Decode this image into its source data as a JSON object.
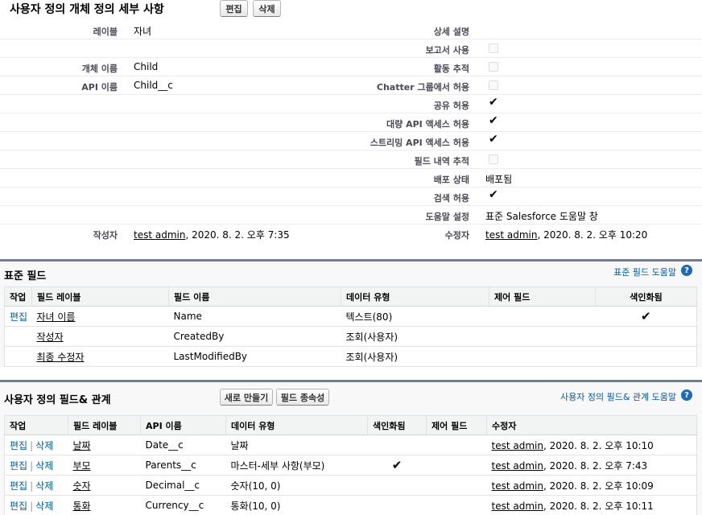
{
  "header": {
    "title": "사용자 정의 개체 정의 세부 사항",
    "edit_label": "편집",
    "delete_label": "삭제"
  },
  "detail": {
    "left": [
      {
        "label": "레이블",
        "value": "자녀"
      },
      {
        "label": "",
        "value": ""
      },
      {
        "label": "개체 이름",
        "value": "Child"
      },
      {
        "label": "API 이름",
        "value": "Child__c"
      }
    ],
    "right": [
      {
        "label": "상세 설명",
        "type": "text",
        "value": ""
      },
      {
        "label": "보고서 사용",
        "type": "unchecked"
      },
      {
        "label": "활동 추적",
        "type": "unchecked"
      },
      {
        "label": "Chatter 그룹에서 허용",
        "type": "unchecked"
      },
      {
        "label": "공유 허용",
        "type": "checked"
      },
      {
        "label": "대량 API 액세스 허용",
        "type": "checked"
      },
      {
        "label": "스트리밍 API 액세스 허용",
        "type": "checked"
      },
      {
        "label": "필드 내역 추적",
        "type": "unchecked"
      },
      {
        "label": "배포 상태",
        "type": "text",
        "value": "배포됨"
      },
      {
        "label": "검색 허용",
        "type": "checked"
      },
      {
        "label": "도움말 설정",
        "type": "text",
        "value": "표준 Salesforce 도움말 창"
      }
    ],
    "created_by_label": "작성자",
    "created_by_user": "test admin",
    "created_by_date": ", 2020. 8. 2. 오후 7:35",
    "modified_by_label": "수정자",
    "modified_by_user": "test admin",
    "modified_by_date": ", 2020. 8. 2. 오후 10:20"
  },
  "standard_fields": {
    "title": "표준 필드",
    "help_label": "표준 필드 도움말",
    "columns": [
      "작업",
      "필드 레이블",
      "필드 이름",
      "데이터 유형",
      "제어 필드",
      "색인화됨"
    ],
    "rows": [
      {
        "action": "편집",
        "label": "자녀 이름",
        "name": "Name",
        "type": "텍스트(80)",
        "controlling": "",
        "indexed": true
      },
      {
        "action": "",
        "label": "작성자",
        "name": "CreatedBy",
        "type": "조회(사용자)",
        "controlling": "",
        "indexed": false
      },
      {
        "action": "",
        "label": "최종 수정자",
        "name": "LastModifiedBy",
        "type": "조회(사용자)",
        "controlling": "",
        "indexed": false
      }
    ]
  },
  "custom_fields": {
    "title": "사용자 정의 필드& 관계",
    "new_label": "새로 만들기",
    "deps_label": "필드 종속성",
    "help_label": "사용자 정의 필드& 관계 도움말",
    "columns": [
      "작업",
      "필드 레이블",
      "API 이름",
      "데이터 유형",
      "색인화됨",
      "제어 필드",
      "수정자"
    ],
    "rows": [
      {
        "edit": "편집",
        "del": "삭제",
        "label": "날짜",
        "api": "Date__c",
        "type": "날짜",
        "indexed": false,
        "controlling": "",
        "mod_user": "test admin",
        "mod_date": ", 2020. 8. 2. 오후 10:10"
      },
      {
        "edit": "편집",
        "del": "삭제",
        "label": "부모",
        "api": "Parents__c",
        "type": "마스터-세부 사항(부모)",
        "indexed": true,
        "controlling": "",
        "mod_user": "test admin",
        "mod_date": ", 2020. 8. 2. 오후 7:43"
      },
      {
        "edit": "편집",
        "del": "삭제",
        "label": "숫자",
        "api": "Decimal__c",
        "type": "숫자(10, 0)",
        "indexed": false,
        "controlling": "",
        "mod_user": "test admin",
        "mod_date": ", 2020. 8. 2. 오후 10:09"
      },
      {
        "edit": "편집",
        "del": "삭제",
        "label": "통화",
        "api": "Currency__c",
        "type": "통화(10, 0)",
        "indexed": false,
        "controlling": "",
        "mod_user": "test admin",
        "mod_date": ", 2020. 8. 2. 오후 10:11"
      }
    ]
  },
  "icons": {
    "help": "help-icon",
    "check": "checkmark-icon"
  },
  "colors": {
    "accent": "#015ba7",
    "section_border": "#767c8a",
    "help_icon": "#1e6ab5"
  }
}
